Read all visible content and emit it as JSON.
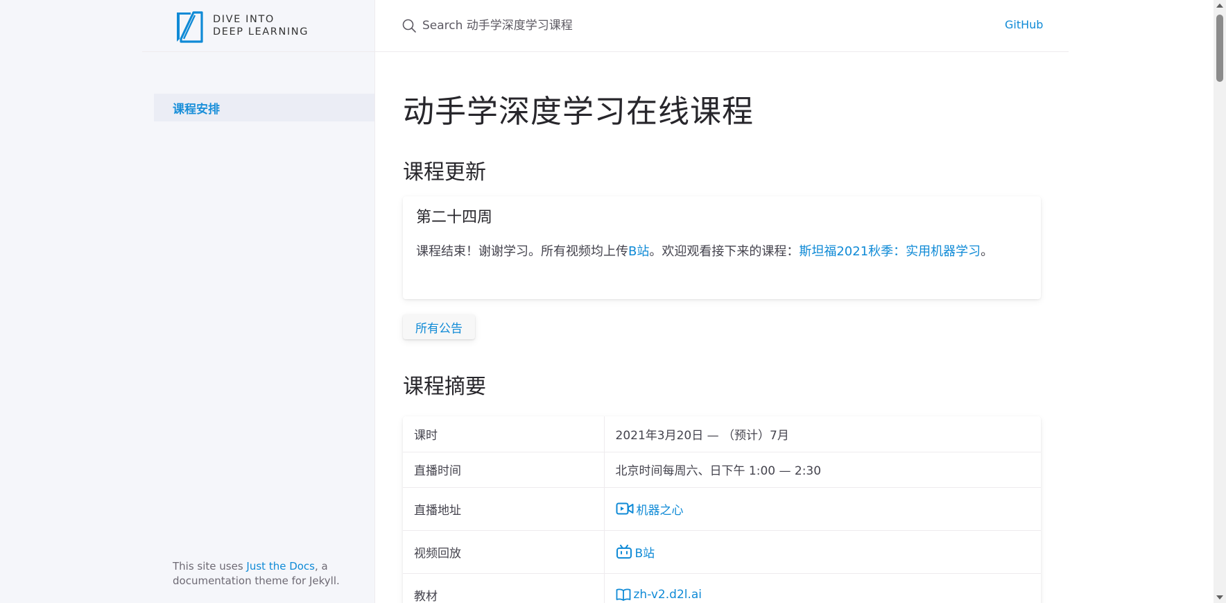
{
  "brand": {
    "line1": "DIVE INTO",
    "line2": "DEEP LEARNING",
    "accent": "#0f8ad6"
  },
  "sidebar": {
    "items": [
      {
        "label": "课程安排",
        "active": true
      }
    ],
    "footer": {
      "prefix": "This site uses ",
      "link": "Just the Docs",
      "suffix": ", a documentation theme for Jekyll."
    }
  },
  "header": {
    "search_placeholder": "Search 动手学深度学习课程",
    "github": "GitHub"
  },
  "main": {
    "title": "动手学深度学习在线课程",
    "updates": {
      "heading": "课程更新",
      "card": {
        "title": "第二十四周",
        "text1": "课程结束！谢谢学习。所有视频均上传",
        "link1": "B站",
        "text2": "。欢迎观看接下来的课程：",
        "link2": "斯坦福2021秋季：实用机器学习",
        "text3": "。"
      },
      "button": "所有公告"
    },
    "summary": {
      "heading": "课程摘要",
      "rows": [
        {
          "key": "课时",
          "value": "2021年3月20日 — （预计）7月"
        },
        {
          "key": "直播时间",
          "value": "北京时间每周六、日下午 1:00 — 2:30"
        },
        {
          "key": "直播地址",
          "value": "机器之心",
          "icon": "video-camera-icon"
        },
        {
          "key": "视频回放",
          "value": "B站",
          "icon": "bilibili-icon"
        },
        {
          "key": "教材",
          "value": "zh-v2.d2l.ai",
          "icon": "book-icon"
        }
      ]
    }
  }
}
